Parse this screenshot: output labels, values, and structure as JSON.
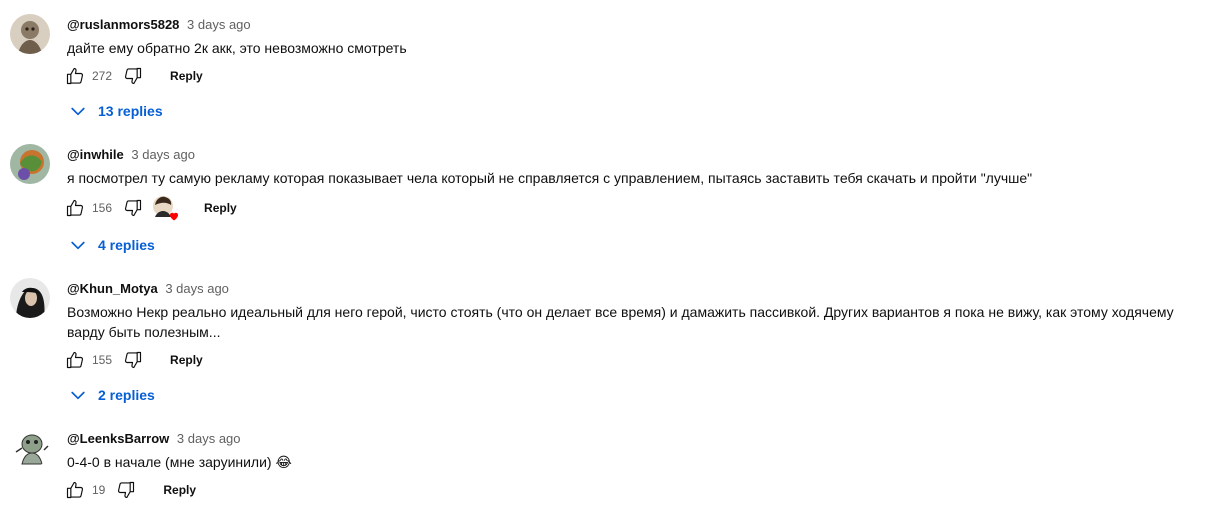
{
  "comments": [
    {
      "author": "@ruslanmors5828",
      "time": "3 days ago",
      "text": "дайте ему обратно 2к акк, это невозможно смотреть",
      "likes": "272",
      "reply_label": "Reply",
      "replies_label": "13 replies",
      "creator_heart": false
    },
    {
      "author": "@inwhile",
      "time": "3 days ago",
      "text": "я посмотрел ту самую рекламу которая показывает чела который не справляется с управлением, пытаясь заставить тебя скачать и пройти \"лучше\"",
      "likes": "156",
      "reply_label": "Reply",
      "replies_label": "4 replies",
      "creator_heart": true
    },
    {
      "author": "@Khun_Motya",
      "time": "3 days ago",
      "text": "Возможно Некр реально идеальный для него герой, чисто стоять (что он делает все время) и дамажить пассивкой. Других вариантов я пока не вижу, как этому ходячему варду быть полезным...",
      "likes": "155",
      "reply_label": "Reply",
      "replies_label": "2 replies",
      "creator_heart": false
    },
    {
      "author": "@LeenksBarrow",
      "time": "3 days ago",
      "text": "0-4-0 в начале (мне заруинили) 😂",
      "likes": "19",
      "reply_label": "Reply",
      "creator_heart": false
    }
  ],
  "icons": {
    "like": "thumbs-up-icon",
    "dislike": "thumbs-down-icon",
    "expand": "chevron-down-icon",
    "heart": "creator-heart-icon"
  },
  "colors": {
    "link_blue": "#065fd4",
    "muted": "#606060",
    "heart": "#ff0000"
  }
}
